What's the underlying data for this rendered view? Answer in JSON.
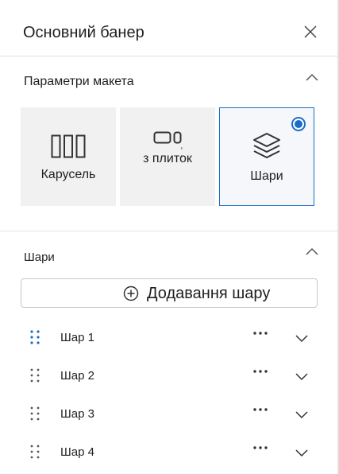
{
  "header": {
    "title": "Основний банер"
  },
  "layout_section": {
    "title": "Параметри макета",
    "options": [
      {
        "label": "Карусель",
        "icon": "carousel-icon",
        "selected": false
      },
      {
        "label": "з плиток",
        "icon": "tiles-icon",
        "selected": false
      },
      {
        "label": "Шари",
        "icon": "layers-icon",
        "selected": true
      }
    ]
  },
  "layers_section": {
    "title": "Шари",
    "add_label": "Додавання шару",
    "layers": [
      {
        "label": "Шар 1"
      },
      {
        "label": "Шар 2"
      },
      {
        "label": "Шар 3"
      },
      {
        "label": "Шар 4"
      }
    ]
  },
  "colors": {
    "accent": "#1a6ec8",
    "card_bg": "#f1f1f1",
    "border": "#c8c8c8"
  }
}
